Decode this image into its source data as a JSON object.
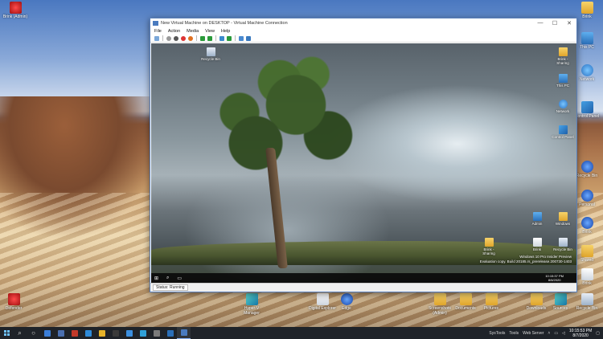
{
  "vm_window": {
    "title": "New Virtual Machine on DESKTOP - Virtual Machine Connection",
    "menu": [
      "File",
      "Action",
      "Media",
      "View",
      "Help"
    ],
    "window_buttons": [
      "—",
      "☐",
      "✕"
    ],
    "status": "Status: Running"
  },
  "guest": {
    "icons": {
      "recycle": "Recycle Bin",
      "pc": "This PC",
      "network": "Network",
      "control_panel": "Control Panel",
      "admin": "Admin",
      "windows": "Windows",
      "recycle_bin": "Recycle Bin",
      "user": "Brink",
      "user_folder": "Brink - Sharing"
    },
    "watermark": {
      "line1": "Windows 10 Pro Insider Preview",
      "line2": "Evaluation copy. Build 20185.rs_prerelease.200730-1403"
    },
    "clock": {
      "time": "10:15:37 PM",
      "date": "8/6/2020"
    }
  },
  "host": {
    "desktop_icons": {
      "top_left": "Brink (Admin)",
      "folder_top_right": "Brink",
      "this_pc": "This PC",
      "network": "Network",
      "control_panel": "Control Panel",
      "right_mid1": "Recycle Bin",
      "right_mid2": "Personal",
      "right_mid3": "Brink",
      "right_mid4": "Shared",
      "right_low1": "Brink",
      "right_low2": "Recycle Bin",
      "bottom_left": "Defender",
      "hyperv": "Hyper-V Manager",
      "digital": "Digital Explorer",
      "edge": "Edge",
      "screenshots": "Screenshots (Admin)",
      "documents": "Documents",
      "pictures": "Pictures",
      "downloads": "Downloads",
      "sources": "Sources",
      "recycle": "Recycle Bin"
    },
    "taskbar": {
      "toolbars": [
        "SysTools",
        "Tools",
        "Web Server"
      ],
      "time": "10:15:53 PM",
      "date": "8/7/2020"
    }
  },
  "colors": {
    "accent": "#4a7bbf",
    "taskbar": "#1f2329"
  }
}
